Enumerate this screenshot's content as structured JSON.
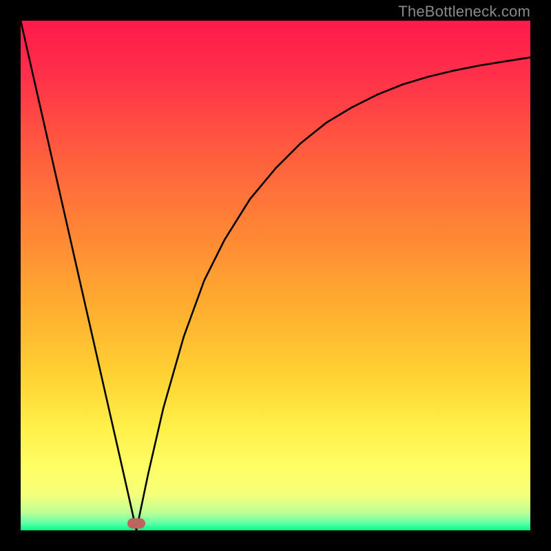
{
  "watermark": "TheBottleneck.com",
  "colors": {
    "frame": "#000000",
    "gradient_stops": [
      {
        "offset": 0.0,
        "color": "#ff1a4b"
      },
      {
        "offset": 0.1,
        "color": "#ff2e4a"
      },
      {
        "offset": 0.25,
        "color": "#ff5a3f"
      },
      {
        "offset": 0.4,
        "color": "#ff8236"
      },
      {
        "offset": 0.55,
        "color": "#ffaa2f"
      },
      {
        "offset": 0.7,
        "color": "#ffd333"
      },
      {
        "offset": 0.8,
        "color": "#fff04a"
      },
      {
        "offset": 0.88,
        "color": "#ffff66"
      },
      {
        "offset": 0.93,
        "color": "#f6ff7a"
      },
      {
        "offset": 0.965,
        "color": "#bfff96"
      },
      {
        "offset": 0.985,
        "color": "#66ffa8"
      },
      {
        "offset": 1.0,
        "color": "#00ff88"
      }
    ],
    "curve": "#000000",
    "marker": "#c0635f"
  },
  "marker": {
    "x_frac": 0.227,
    "y_frac": 0.987
  },
  "chart_data": {
    "type": "line",
    "title": "",
    "xlabel": "",
    "ylabel": "",
    "xlim": [
      0,
      100
    ],
    "ylim": [
      0,
      100
    ],
    "x": [
      0,
      5,
      10,
      15,
      20,
      22.7,
      25,
      28,
      32,
      36,
      40,
      45,
      50,
      55,
      60,
      65,
      70,
      75,
      80,
      85,
      90,
      95,
      100
    ],
    "values": [
      100,
      78,
      56,
      34,
      12,
      0,
      11,
      24,
      38,
      49,
      57,
      65,
      71,
      76,
      80,
      83,
      85.5,
      87.5,
      89,
      90.2,
      91.2,
      92,
      92.8
    ],
    "min_point": {
      "x": 22.7,
      "y": 0
    },
    "notes": "V-shaped bottleneck curve over vertical red-to-green gradient. Minimum (optimal match) marked by oval at trough. No axis ticks/labels rendered; values estimated from geometry."
  }
}
